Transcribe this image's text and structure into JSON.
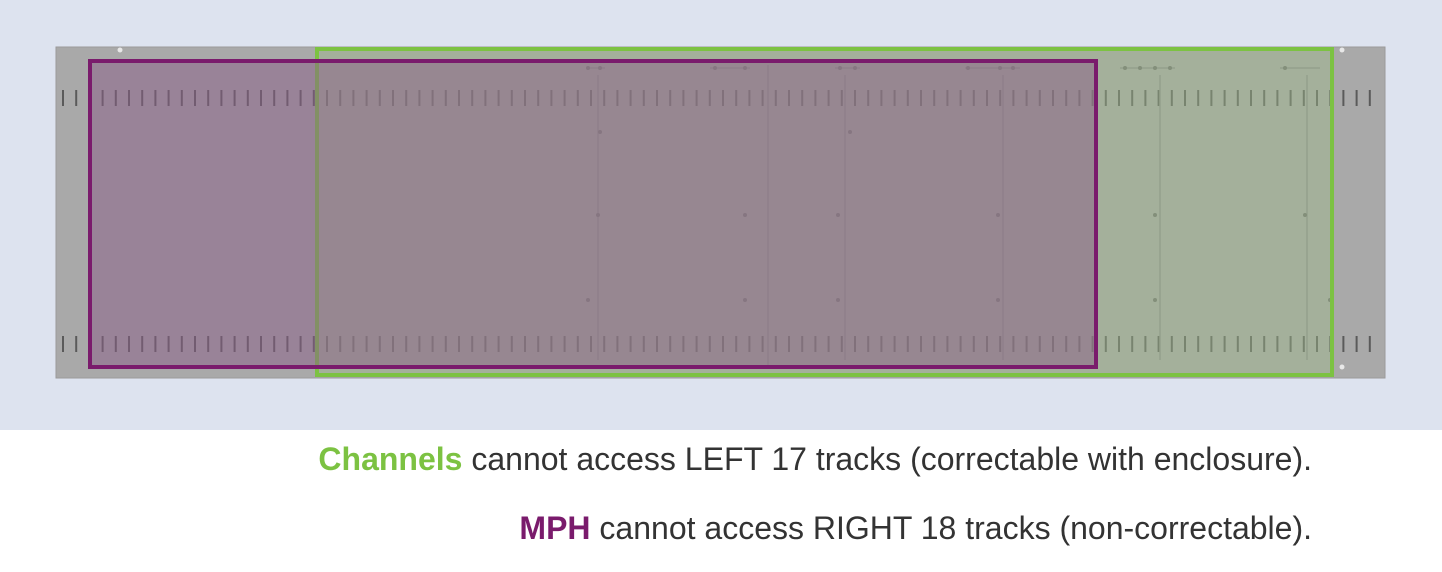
{
  "colors": {
    "channels": "#7cc242",
    "mph": "#7a1b6c",
    "caption_text": "#333333",
    "panel": "#a9a9a9",
    "background": "#dde3ef"
  },
  "captions": [
    {
      "keyword": "Channels",
      "text": " cannot access LEFT 17 tracks (correctable with enclosure).",
      "color_key": "channels"
    },
    {
      "keyword": "MPH",
      "text": " cannot access RIGHT 18 tracks (non-correctable).",
      "color_key": "mph"
    }
  ]
}
